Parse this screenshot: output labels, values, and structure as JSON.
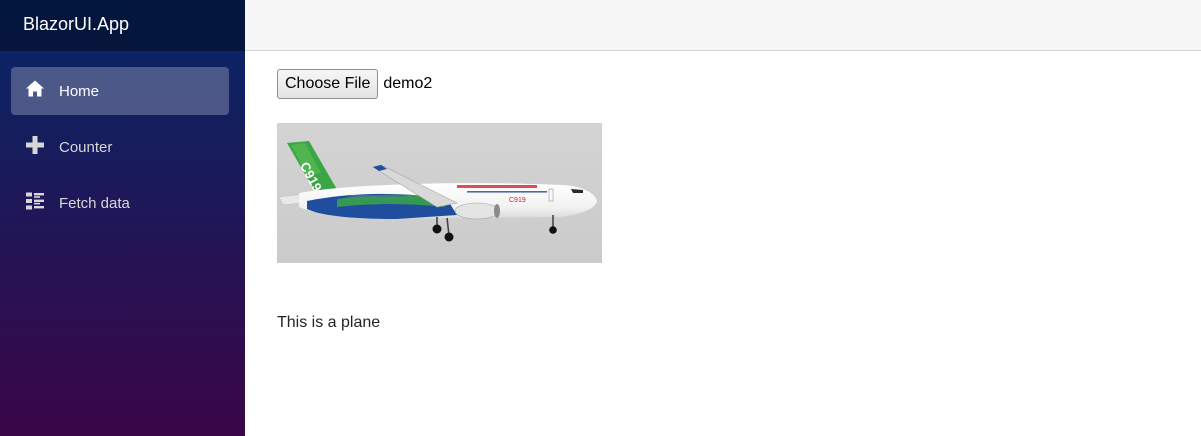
{
  "app": {
    "brand": "BlazorUI.App"
  },
  "sidebar": {
    "items": [
      {
        "label": "Home",
        "icon": "home-icon",
        "active": true
      },
      {
        "label": "Counter",
        "icon": "plus-icon",
        "active": false
      },
      {
        "label": "Fetch data",
        "icon": "list-icon",
        "active": false
      }
    ]
  },
  "main": {
    "file_input": {
      "button_label": "Choose File",
      "selected_file": "demo2"
    },
    "image": {
      "subject": "airplane",
      "tail_text": "C919"
    },
    "caption": "This is a plane"
  },
  "colors": {
    "sidebar_top": "#052767",
    "sidebar_bottom": "#3a0647",
    "topbar": "#f7f7f7",
    "tail_green": "#3aa645",
    "belly_blue": "#1f4e9e"
  }
}
